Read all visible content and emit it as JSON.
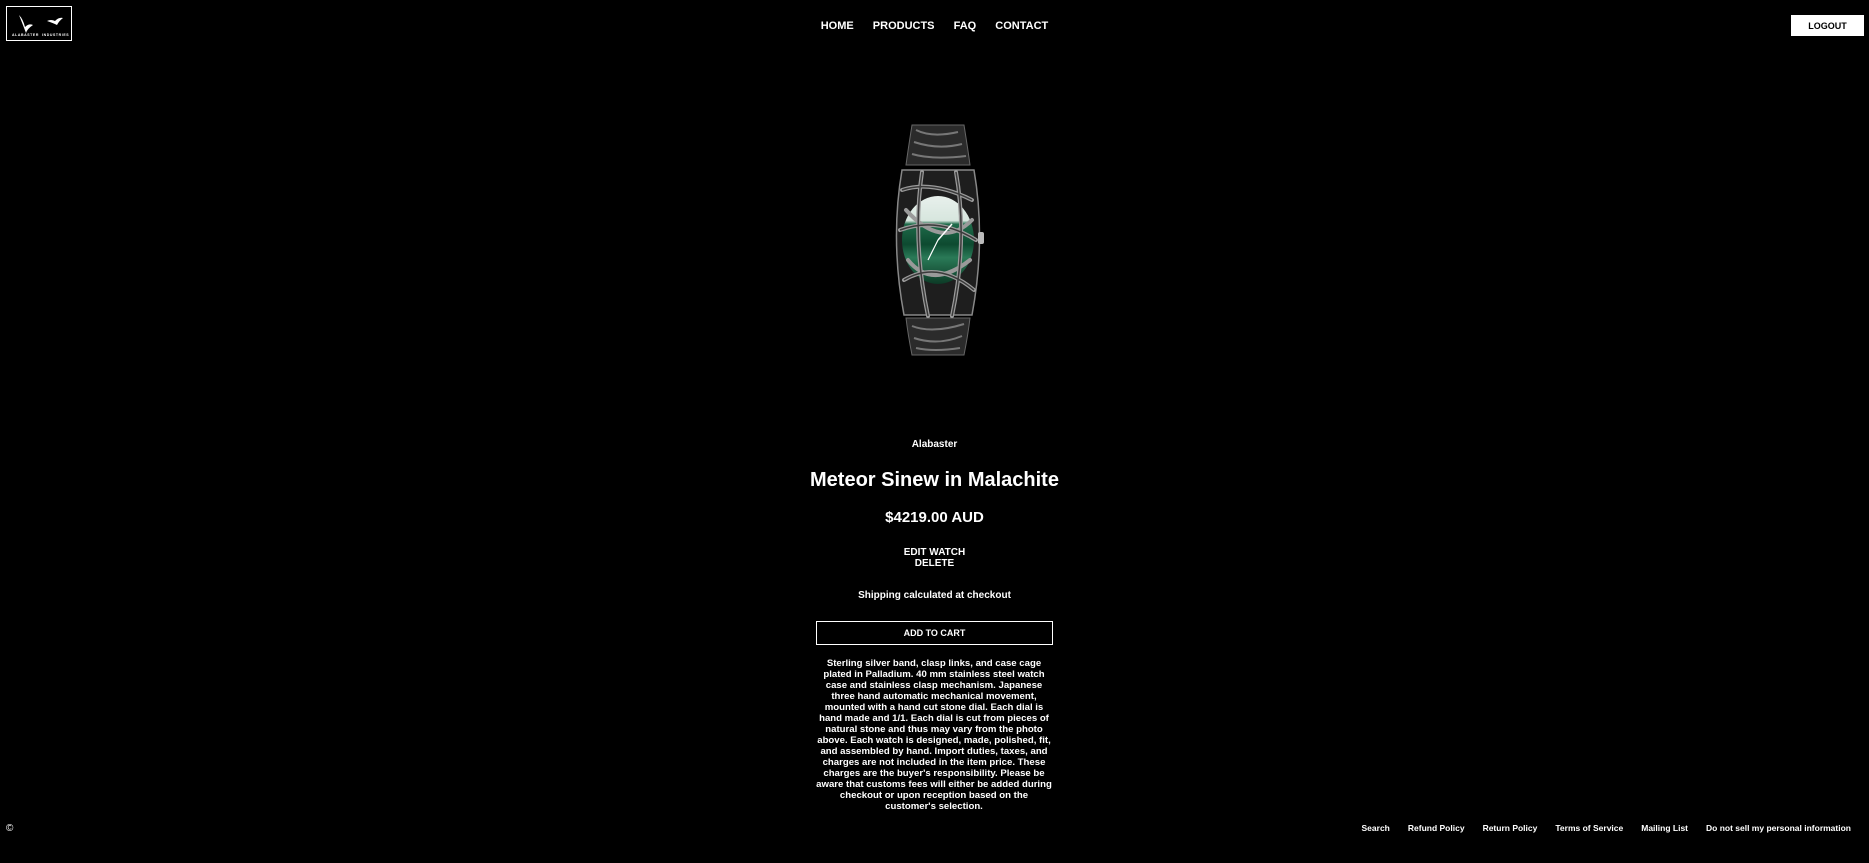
{
  "logo": {
    "left_text": "ALABASTER",
    "right_text": "INDUSTRIES"
  },
  "nav": [
    {
      "label": "HOME"
    },
    {
      "label": "PRODUCTS"
    },
    {
      "label": "FAQ"
    },
    {
      "label": "CONTACT"
    }
  ],
  "header": {
    "logout_label": "LOGOUT"
  },
  "product": {
    "vendor": "Alabaster",
    "title": "Meteor Sinew in Malachite",
    "price": "$4219.00 AUD",
    "edit_label": "EDIT WATCH",
    "delete_label": "DELETE",
    "shipping_note": "Shipping calculated at checkout",
    "add_to_cart_label": "ADD TO CART",
    "description": "Sterling silver band, clasp links, and case cage plated in Palladium. 40 mm stainless steel watch case and stainless clasp mechanism. Japanese three hand automatic mechanical movement, mounted with a hand cut stone dial. Each dial is hand made and 1/1. Each dial is cut from pieces of natural stone and thus may vary from the photo above. Each watch is designed, made, polished, fit, and assembled by hand. Import duties, taxes, and charges are not included in the item price. These charges are the buyer's responsibility. Please be aware that customs fees will either be added during checkout or upon reception based on the customer's selection."
  },
  "footer": {
    "copyright_glyph": "©",
    "links": [
      "Search",
      "Refund Policy",
      "Return Policy",
      "Terms of Service",
      "Mailing List",
      "Do not sell my personal information"
    ]
  },
  "colors": {
    "background": "#000000",
    "text": "#ffffff",
    "dial": "#1f6b4a"
  }
}
